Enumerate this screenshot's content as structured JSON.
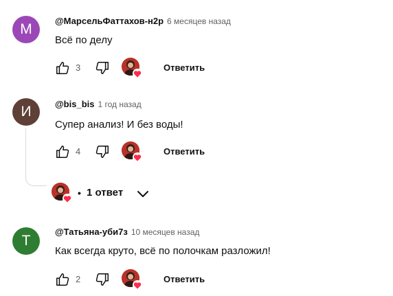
{
  "colors": {
    "avatar_m": "#9c47b8",
    "avatar_i": "#5e4036",
    "avatar_t": "#2f7d32",
    "heart": "#ff2b4a"
  },
  "icons": {
    "like": "thumb-up-icon",
    "dislike": "thumb-down-icon",
    "hearted": "creator-heart-avatar-icon",
    "expand": "chevron-down-icon"
  },
  "comments": [
    {
      "avatar_letter": "М",
      "author": "@МарсельФаттахов-н2р",
      "time": "6 месяцев назад",
      "text": "Всё по делу",
      "likes": "3",
      "reply_label": "Ответить"
    },
    {
      "avatar_letter": "И",
      "author": "@bis_bis",
      "time": "1 год назад",
      "text": "Супер анализ! И без воды!",
      "likes": "4",
      "reply_label": "Ответить",
      "replies": {
        "dot": "•",
        "label": "1 ответ"
      }
    },
    {
      "avatar_letter": "Т",
      "author": "@Татьяна-уби7з",
      "time": "10 месяцев назад",
      "text": "Как всегда круто, всё по полочкам разложил!",
      "likes": "2",
      "reply_label": "Ответить"
    }
  ]
}
